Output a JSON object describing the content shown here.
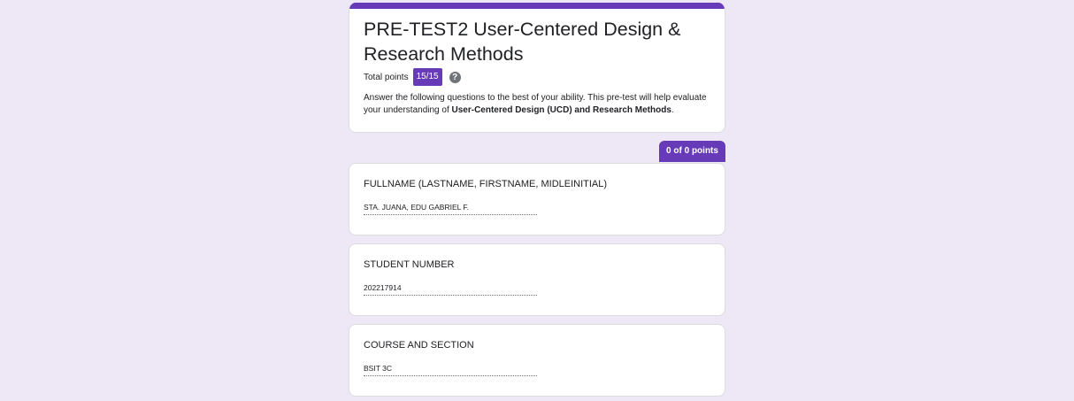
{
  "form": {
    "title": "PRE-TEST2 User-Centered Design & Research Methods",
    "total_points_label": "Total points",
    "total_points_value": "15/15",
    "help_icon": "help-circle-icon",
    "description_intro": " Answer the following questions to the best of your ability. This pre-test will help evaluate your understanding of ",
    "description_bold": "User-Centered Design (UCD) and Research Methods",
    "description_end": ".",
    "accent_color": "#673ab7",
    "background_color": "#ede7f6"
  },
  "section": {
    "points_label": "0 of 0 points"
  },
  "questions": [
    {
      "title": "FULLNAME (LASTNAME, FIRSTNAME, MIDLEINITIAL)",
      "answer": "STA. JUANA, EDU GABRIEL F."
    },
    {
      "title": "STUDENT NUMBER",
      "answer": "202217914"
    },
    {
      "title": "COURSE AND SECTION",
      "answer": "BSIT 3C"
    }
  ]
}
